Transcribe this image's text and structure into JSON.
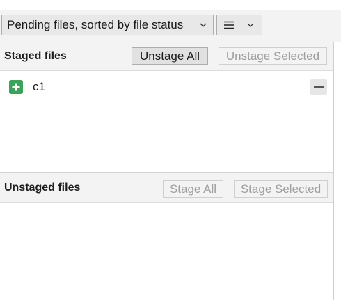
{
  "toolbar": {
    "view_mode_label": "Pending files, sorted by file status",
    "list_mode_icon": "list-icon"
  },
  "staged": {
    "title": "Staged files",
    "unstage_all_label": "Unstage All",
    "unstage_selected_label": "Unstage Selected",
    "files": [
      {
        "name": "c1",
        "status": "added",
        "status_icon": "plus-square-icon",
        "action_icon": "minus-icon"
      }
    ]
  },
  "unstaged": {
    "title": "Unstaged files",
    "stage_all_label": "Stage All",
    "stage_selected_label": "Stage Selected",
    "files": []
  },
  "colors": {
    "added_status": "#3aa55a",
    "toolbar_bg": "#f3f3f3",
    "disabled_text": "#9e9e9e"
  }
}
